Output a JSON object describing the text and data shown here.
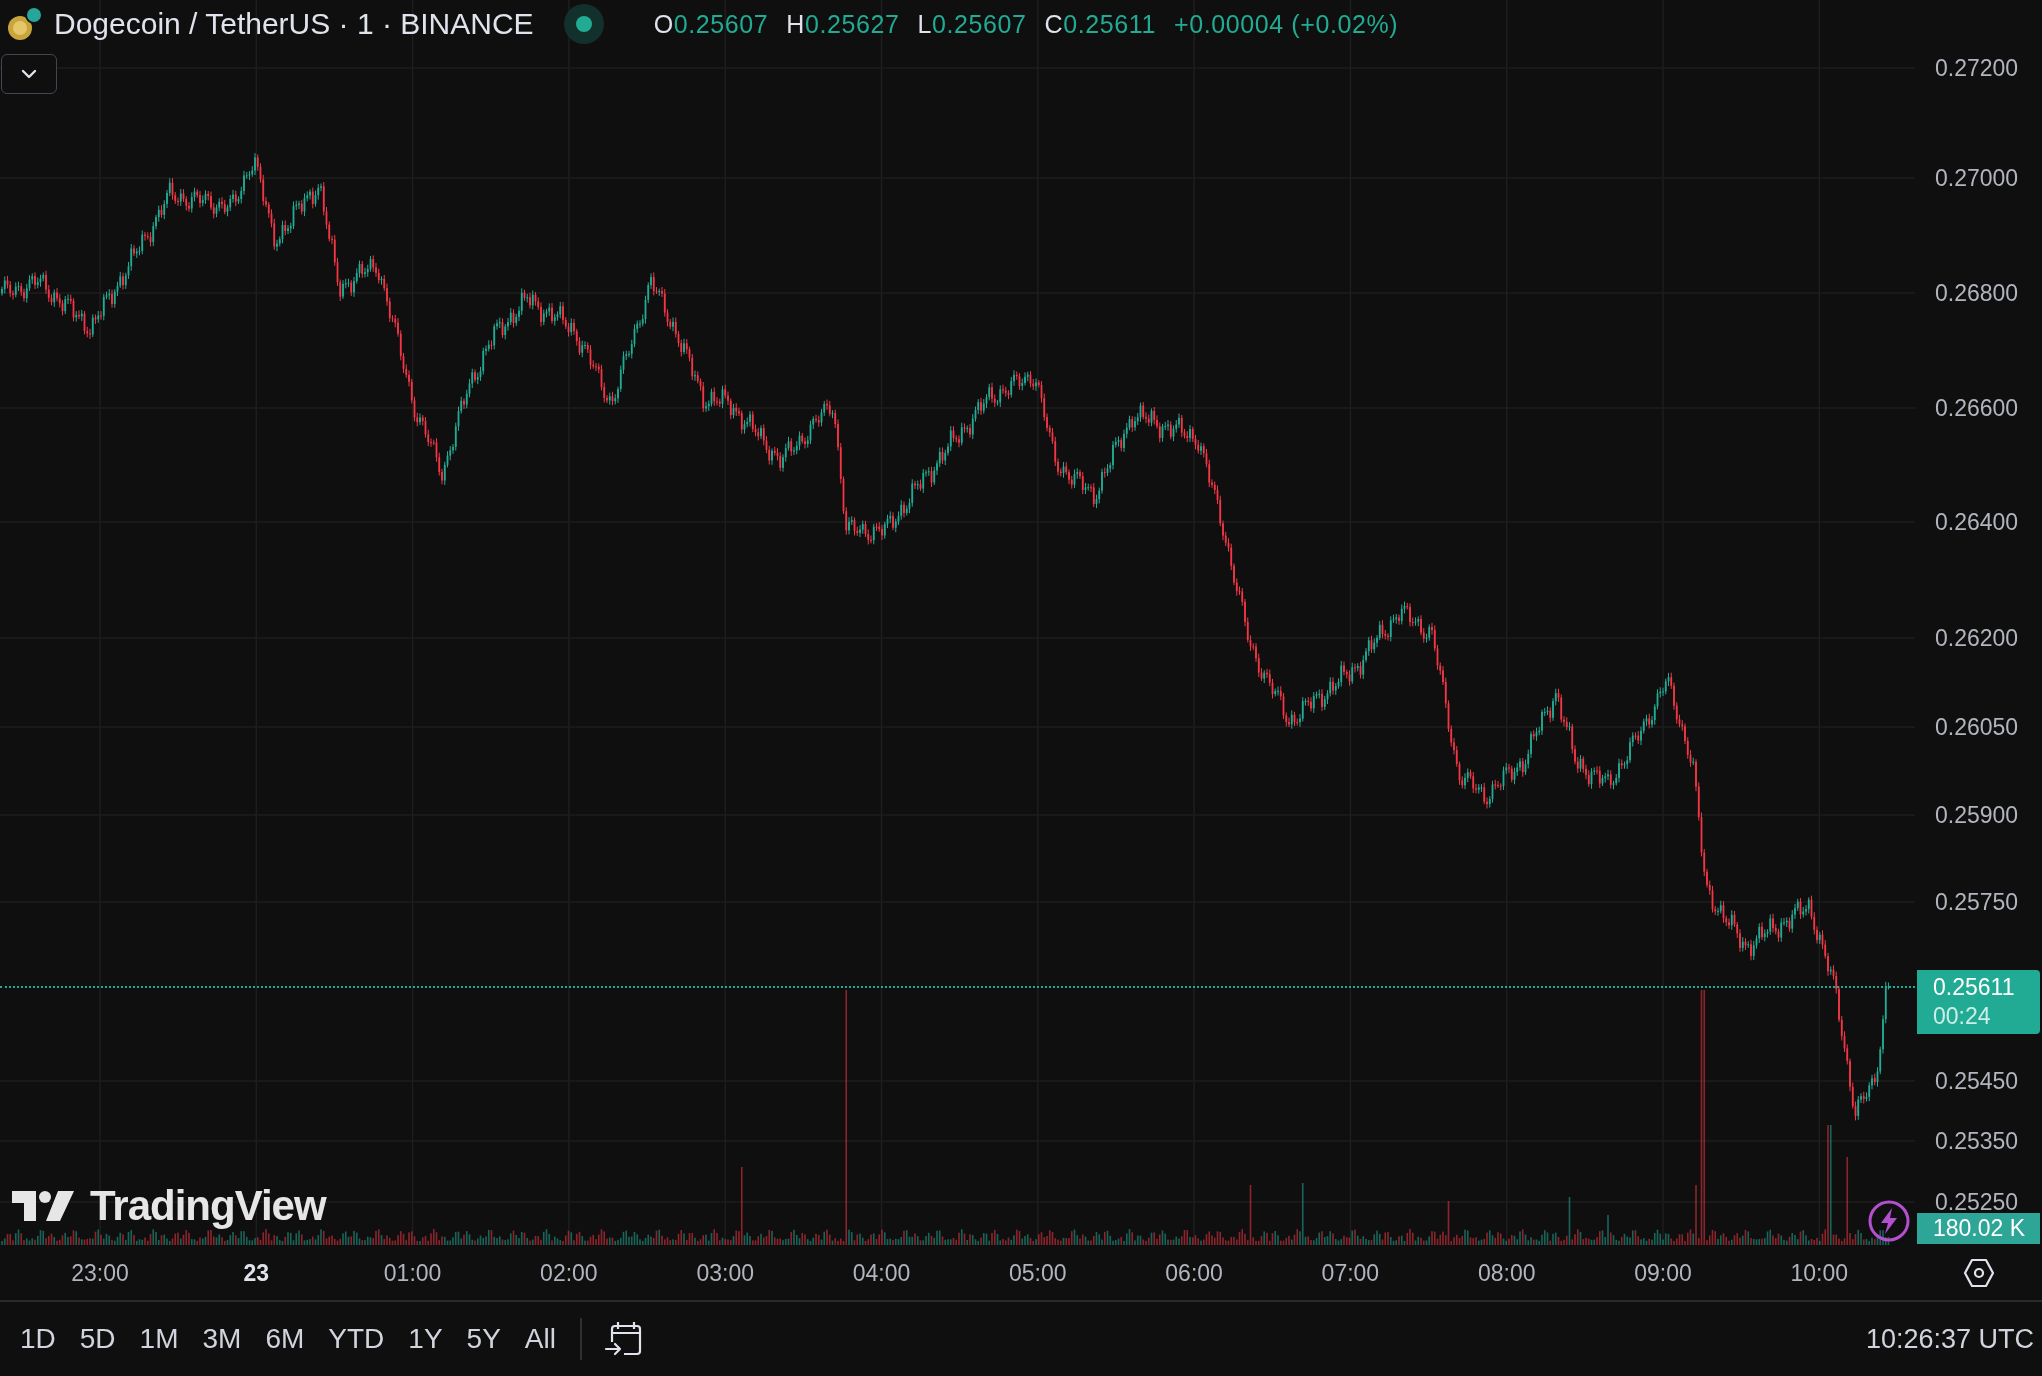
{
  "header": {
    "symbol": "Dogecoin / TetherUS · 1 · BINANCE",
    "ohlc": [
      {
        "label": "O",
        "value": "0.25607"
      },
      {
        "label": "H",
        "value": "0.25627"
      },
      {
        "label": "L",
        "value": "0.25607"
      },
      {
        "label": "C",
        "value": "0.25611"
      }
    ],
    "change": "+0.00004 (+0.02%)"
  },
  "price_axis": {
    "labels": [
      "0.27200",
      "0.27000",
      "0.26800",
      "0.26600",
      "0.26400",
      "0.26200",
      "0.26050",
      "0.25900",
      "0.25750",
      "0.25450",
      "0.25350",
      "0.25250"
    ],
    "price_tag": {
      "price": "0.25611",
      "countdown": "00:24"
    },
    "volume_tag": "180.02 K"
  },
  "watermark_logo": {
    "text": "TradingView"
  },
  "time_axis": [
    {
      "label": "23:00",
      "kind": "time"
    },
    {
      "label": "23",
      "kind": "day"
    },
    {
      "label": "01:00",
      "kind": "time"
    },
    {
      "label": "02:00",
      "kind": "time"
    },
    {
      "label": "03:00",
      "kind": "time"
    },
    {
      "label": "04:00",
      "kind": "time"
    },
    {
      "label": "05:00",
      "kind": "time"
    },
    {
      "label": "06:00",
      "kind": "time"
    },
    {
      "label": "07:00",
      "kind": "time"
    },
    {
      "label": "08:00",
      "kind": "time"
    },
    {
      "label": "09:00",
      "kind": "time"
    },
    {
      "label": "10:00",
      "kind": "time"
    }
  ],
  "ranges": [
    "1D",
    "5D",
    "1M",
    "3M",
    "6M",
    "YTD",
    "1Y",
    "5Y",
    "All"
  ],
  "clock": "10:26:37 UTC"
}
